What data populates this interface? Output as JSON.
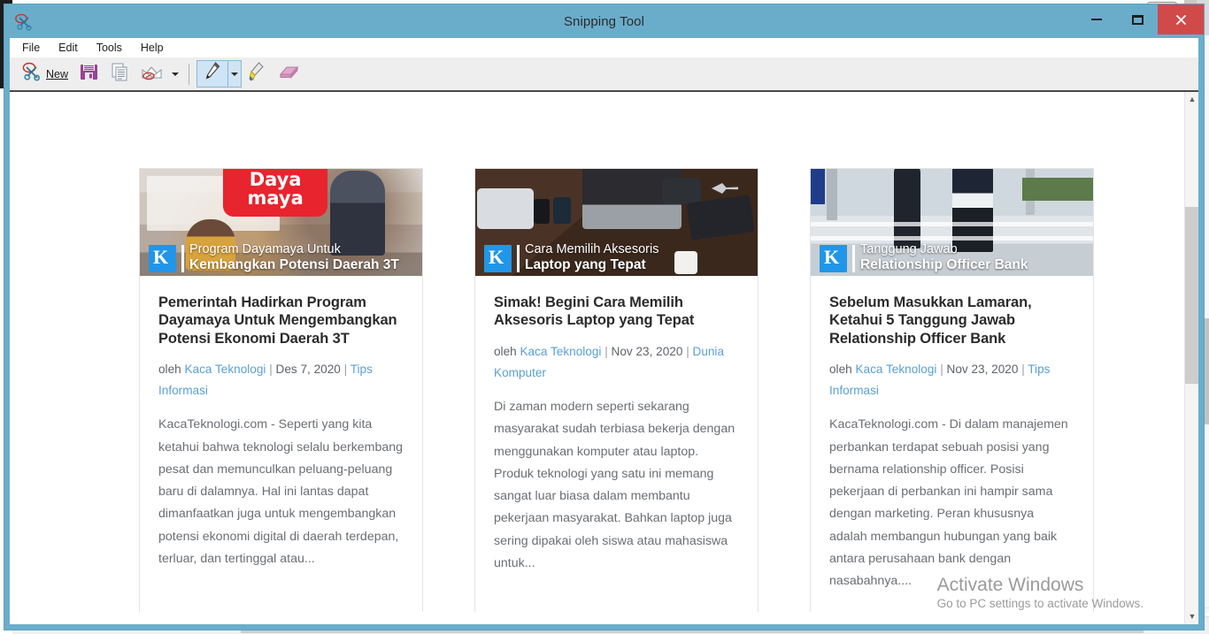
{
  "window": {
    "title": "Snipping Tool",
    "icon": "scissors-icon",
    "controls": {
      "minimize": "Minimize",
      "maximize": "Maximize",
      "close": "Close"
    }
  },
  "menubar": {
    "items": [
      {
        "label": "File"
      },
      {
        "label": "Edit"
      },
      {
        "label": "Tools"
      },
      {
        "label": "Help"
      }
    ]
  },
  "toolbar": {
    "new_label": "New",
    "new_icon": "new-snip-scissors-icon",
    "save_icon": "save-floppy-icon",
    "copy_icon": "copy-pages-icon",
    "email_icon": "email-envelope-icon",
    "email_caret_icon": "chevron-down-icon",
    "pen_icon": "pen-icon",
    "pen_caret_icon": "chevron-down-icon",
    "highlighter_icon": "highlighter-icon",
    "eraser_icon": "eraser-icon"
  },
  "colors": {
    "titlebar": "#6aadcb",
    "close_button": "#d04a4a",
    "toolbar_bg": "#eeeeee",
    "toolbar_border": "#494949",
    "link": "#5a9fd4",
    "brand_blue": "#2196e8",
    "body_text": "#6b6f73",
    "title_text": "#2b2b2b"
  },
  "cards": [
    {
      "thumb": {
        "logo_letter": "K",
        "overlay_line1": "Program Dayamaya Untuk",
        "overlay_line2": "Kembangkan Potensi Daerah 3T",
        "badge_line1": "Daya",
        "badge_line2": "maya"
      },
      "title": "Pemerintah Hadirkan Program Dayamaya Untuk Mengembangkan Potensi Ekonomi Daerah 3T",
      "meta": {
        "by": "oleh",
        "author": "Kaca Teknologi",
        "date": "Des 7, 2020",
        "categories": "Tips Informasi"
      },
      "excerpt": "KacaTeknologi.com - Seperti yang kita ketahui bahwa teknologi selalu berkembang pesat dan memunculkan peluang-peluang baru di dalamnya. Hal ini lantas dapat dimanfaatkan juga untuk mengembangkan potensi ekonomi digital di daerah terdepan, terluar, dan tertinggal atau..."
    },
    {
      "thumb": {
        "logo_letter": "K",
        "overlay_line1": "Cara Memilih Aksesoris",
        "overlay_line2": "Laptop yang Tepat",
        "badge_line1": "",
        "badge_line2": ""
      },
      "title": "Simak! Begini Cara Memilih Aksesoris Laptop yang Tepat",
      "meta": {
        "by": "oleh",
        "author": "Kaca Teknologi",
        "date": "Nov 23, 2020",
        "categories": "Dunia Komputer"
      },
      "excerpt": "Di zaman modern seperti sekarang masyarakat sudah terbiasa bekerja dengan menggunakan komputer atau laptop. Produk teknologi yang satu ini memang sangat luar biasa dalam membantu pekerjaan masyarakat. Bahkan laptop juga sering dipakai oleh siswa atau mahasiswa untuk..."
    },
    {
      "thumb": {
        "logo_letter": "K",
        "overlay_line1": "Tanggung Jawab",
        "overlay_line2": "Relationship Officer Bank",
        "badge_line1": "",
        "badge_line2": ""
      },
      "title": "Sebelum Masukkan Lamaran, Ketahui 5 Tanggung Jawab Relationship Officer Bank",
      "meta": {
        "by": "oleh",
        "author": "Kaca Teknologi",
        "date": "Nov 23, 2020",
        "categories": "Tips Informasi"
      },
      "excerpt": "KacaTeknologi.com - Di dalam manajemen perbankan terdapat sebuah posisi yang bernama relationship officer. Posisi pekerjaan di perbankan ini hampir sama dengan marketing. Peran khususnya adalah membangun hubungan yang baik antara perusahaan bank dengan nasabahnya...."
    }
  ],
  "watermark": {
    "title": "Activate Windows",
    "subtitle": "Go to PC settings to activate Windows."
  },
  "scrollbars": {
    "up_arrow": "▲",
    "down_arrow": "▼",
    "left_arrow": "◀",
    "right_arrow": "▶"
  }
}
